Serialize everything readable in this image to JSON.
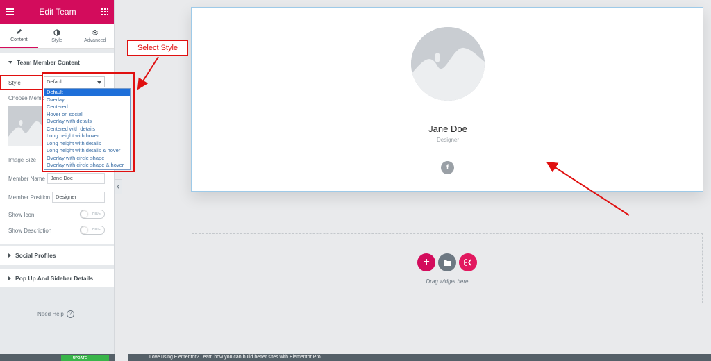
{
  "editor": {
    "title": "Edit Team",
    "tabs": [
      {
        "label": "Content",
        "icon": "pencil-icon"
      },
      {
        "label": "Style",
        "icon": "half-circle-icon"
      },
      {
        "label": "Advanced",
        "icon": "gear-icon"
      }
    ]
  },
  "section_team": {
    "title": "Team Member Content",
    "style_label": "Style",
    "style_value": "Default",
    "style_options": [
      "Default",
      "Overlay",
      "Centered",
      "Hover on social",
      "Overlay with details",
      "Centered with details",
      "Long height with hover",
      "Long height with details",
      "Long height with details & hover",
      "Overlay with circle shape",
      "Overlay with circle shape & hover"
    ],
    "choose_member_label": "Choose Memb",
    "image_size_label": "Image Size",
    "member_name_label": "Member Name",
    "member_name_value": "Jane Doe",
    "member_position_label": "Member Position",
    "member_position_value": "Designer",
    "show_icon_label": "Show Icon",
    "show_icon_toggle": "HIDE",
    "show_description_label": "Show Description",
    "show_description_toggle": "HIDE"
  },
  "sections_closed": [
    "Social Profiles",
    "Pop Up And Sidebar Details"
  ],
  "need_help": "Need Help",
  "update_button": "UPDATE",
  "canvas": {
    "name": "Jane Doe",
    "position": "Designer",
    "social_icon": "f",
    "drop_text": "Drag widget here"
  },
  "bottom_bar_text": "Love using Elementor? Learn how you can build better sites with Elementor Pro.",
  "annotation": {
    "callout": "Select Style"
  },
  "colors": {
    "accent": "#d30c5c",
    "annotation": "#e01010",
    "selected_option": "#1e6fd9",
    "update": "#39b54a"
  }
}
